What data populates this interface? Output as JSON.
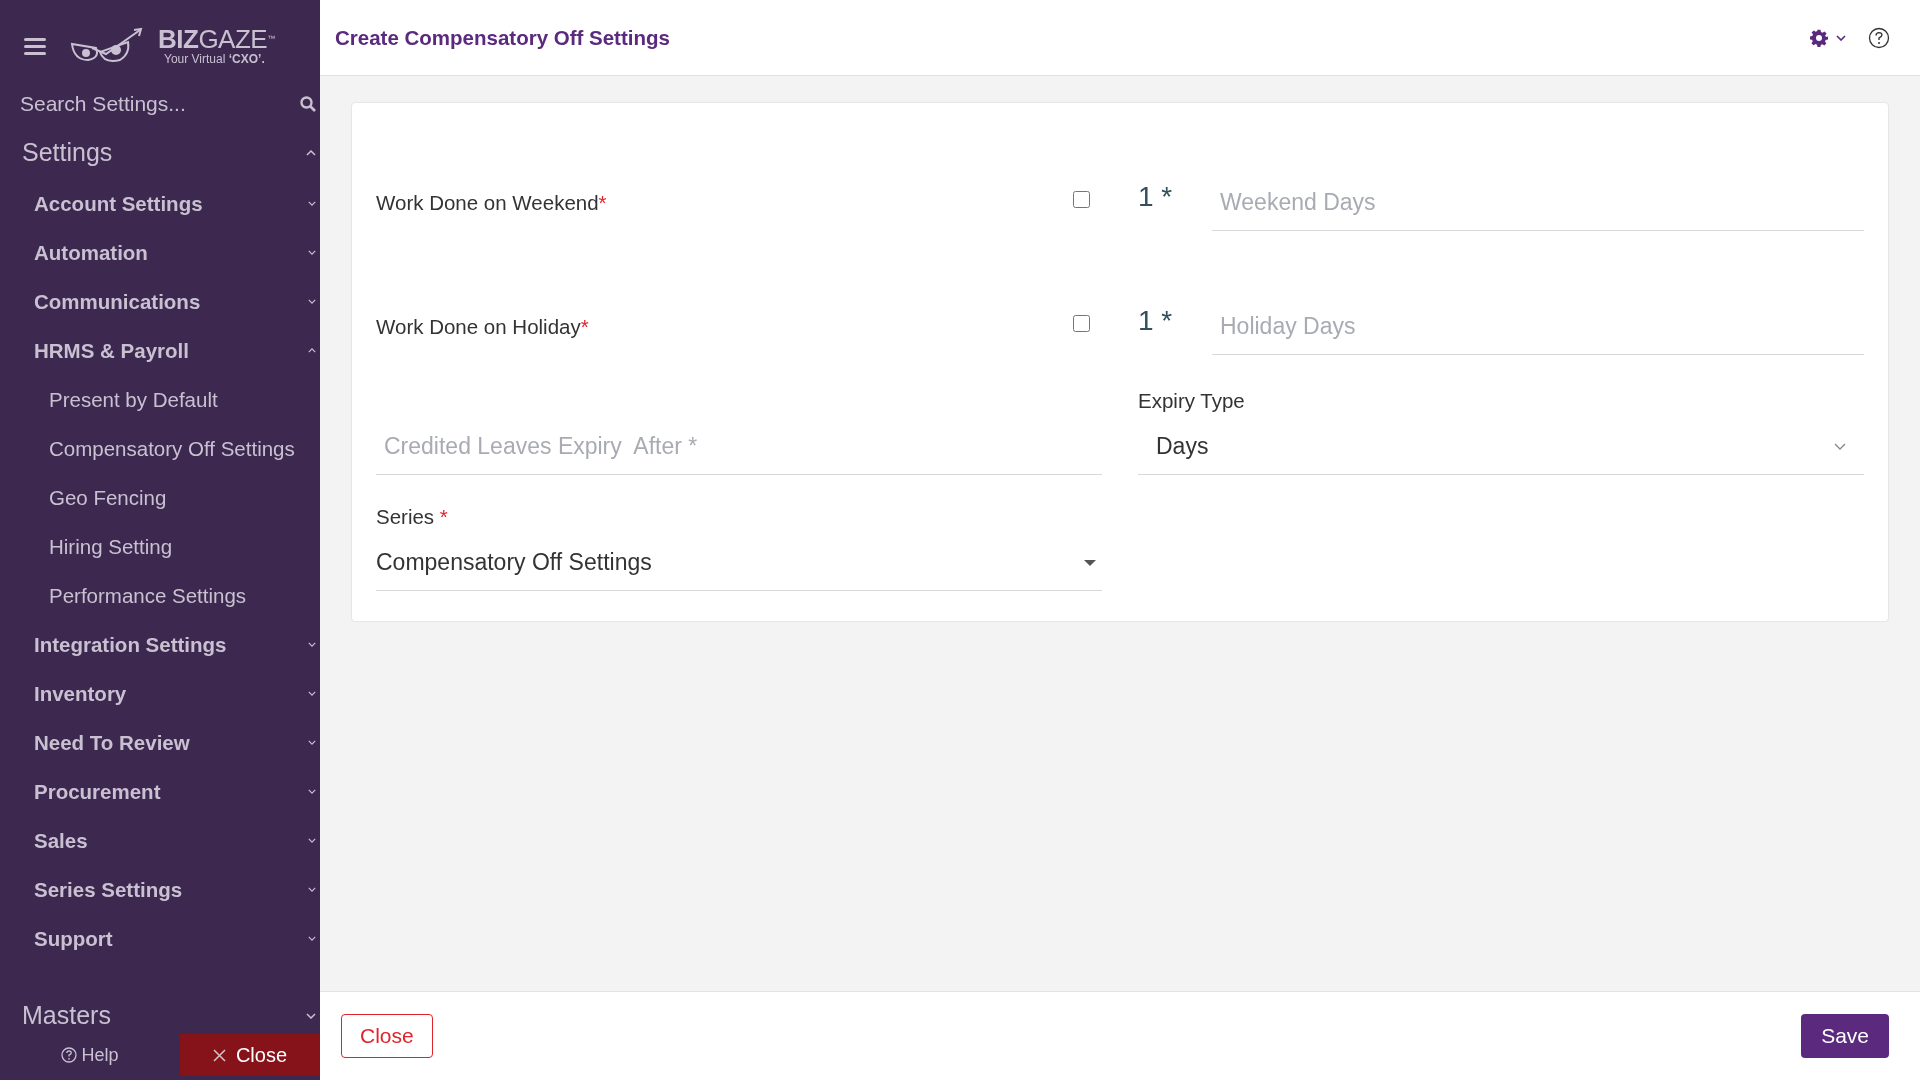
{
  "sidebar": {
    "logo": {
      "brand": "**BIZ**GAZE",
      "trademark": "™",
      "tagline": "Your Virtual **‘CXO’.**"
    },
    "search": {
      "placeholder": "Search Settings..."
    },
    "sections": [
      {
        "title": "Settings",
        "expanded": true,
        "items": [
          {
            "label": "Account Settings",
            "expanded": false
          },
          {
            "label": "Automation",
            "expanded": false
          },
          {
            "label": "Communications",
            "expanded": false
          },
          {
            "label": "HRMS & Payroll",
            "expanded": true,
            "children": [
              {
                "label": "Present by Default"
              },
              {
                "label": "Compensatory Off Settings"
              },
              {
                "label": "Geo Fencing"
              },
              {
                "label": "Hiring Setting"
              },
              {
                "label": "Performance Settings"
              }
            ]
          },
          {
            "label": "Integration Settings",
            "expanded": false
          },
          {
            "label": "Inventory",
            "expanded": false
          },
          {
            "label": "Need To Review",
            "expanded": false
          },
          {
            "label": "Procurement",
            "expanded": false
          },
          {
            "label": "Sales",
            "expanded": false
          },
          {
            "label": "Series Settings",
            "expanded": false
          },
          {
            "label": "Support",
            "expanded": false
          }
        ]
      },
      {
        "title": "Masters",
        "expanded": false
      }
    ],
    "help": "Help",
    "close": "Close"
  },
  "header": {
    "title": "Create Compensatory Off Settings"
  },
  "form": {
    "weekend": {
      "label": "Work Done on Weekend",
      "required_mark": "*",
      "checked": false,
      "count": "1 *",
      "placeholder": "Weekend Days"
    },
    "holiday": {
      "label": "Work Done on Holiday",
      "required_mark": "*",
      "checked": false,
      "count": "1 *",
      "placeholder": "Holiday Days"
    },
    "expiry": {
      "placeholder": "Credited Leaves Expiry  After *"
    },
    "expiry_type": {
      "label": "Expiry Type",
      "value": "Days"
    },
    "series": {
      "label": "Series",
      "required_mark": "*",
      "value": "Compensatory Off Settings"
    }
  },
  "footer": {
    "close": "Close",
    "save": "Save"
  }
}
